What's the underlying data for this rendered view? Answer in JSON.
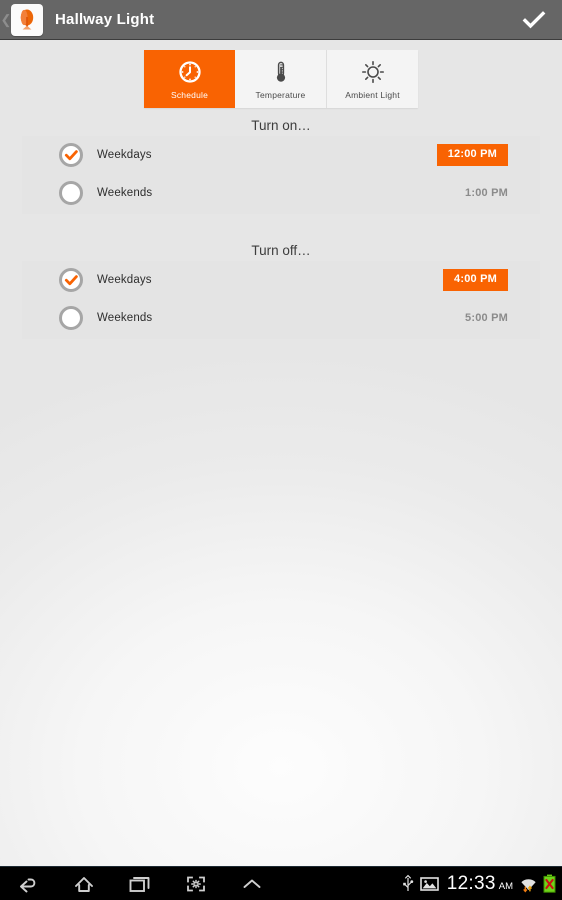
{
  "appbar": {
    "back_icon": "back-chevron-icon",
    "app_icon": "lamp-tree-icon",
    "title": "Hallway Light",
    "done_icon": "checkmark-icon"
  },
  "tabs": [
    {
      "label": "Schedule",
      "icon": "clock-icon",
      "active": true
    },
    {
      "label": "Temperature",
      "icon": "thermometer-icon",
      "active": false
    },
    {
      "label": "Ambient Light",
      "icon": "sun-icon",
      "active": false
    }
  ],
  "sections": [
    {
      "title": "Turn on…",
      "rows": [
        {
          "label": "Weekdays",
          "time": "12:00 PM",
          "selected": true
        },
        {
          "label": "Weekends",
          "time": "1:00 PM",
          "selected": false
        }
      ]
    },
    {
      "title": "Turn off…",
      "rows": [
        {
          "label": "Weekdays",
          "time": "4:00 PM",
          "selected": true
        },
        {
          "label": "Weekends",
          "time": "5:00 PM",
          "selected": false
        }
      ]
    }
  ],
  "navbar": {
    "buttons": [
      {
        "icon": "back-icon"
      },
      {
        "icon": "home-icon"
      },
      {
        "icon": "recents-icon"
      },
      {
        "icon": "screenshot-icon"
      },
      {
        "icon": "chevron-up-icon"
      }
    ],
    "status": {
      "usb_icon": "usb-icon",
      "image_icon": "image-icon",
      "time": "12:33",
      "ampm": "AM",
      "wifi_icon": "wifi-icon",
      "battery_icon": "battery-error-icon"
    }
  },
  "colors": {
    "accent_orange": "#f96302",
    "appbar_gray": "#666666",
    "card_gray": "#e4e4e4",
    "page_gray": "#ececec",
    "radio_ring": "#a6a6a6",
    "navbar_black": "#000000",
    "battery_green": "#5cc400",
    "battery_red": "#d01f1f"
  }
}
